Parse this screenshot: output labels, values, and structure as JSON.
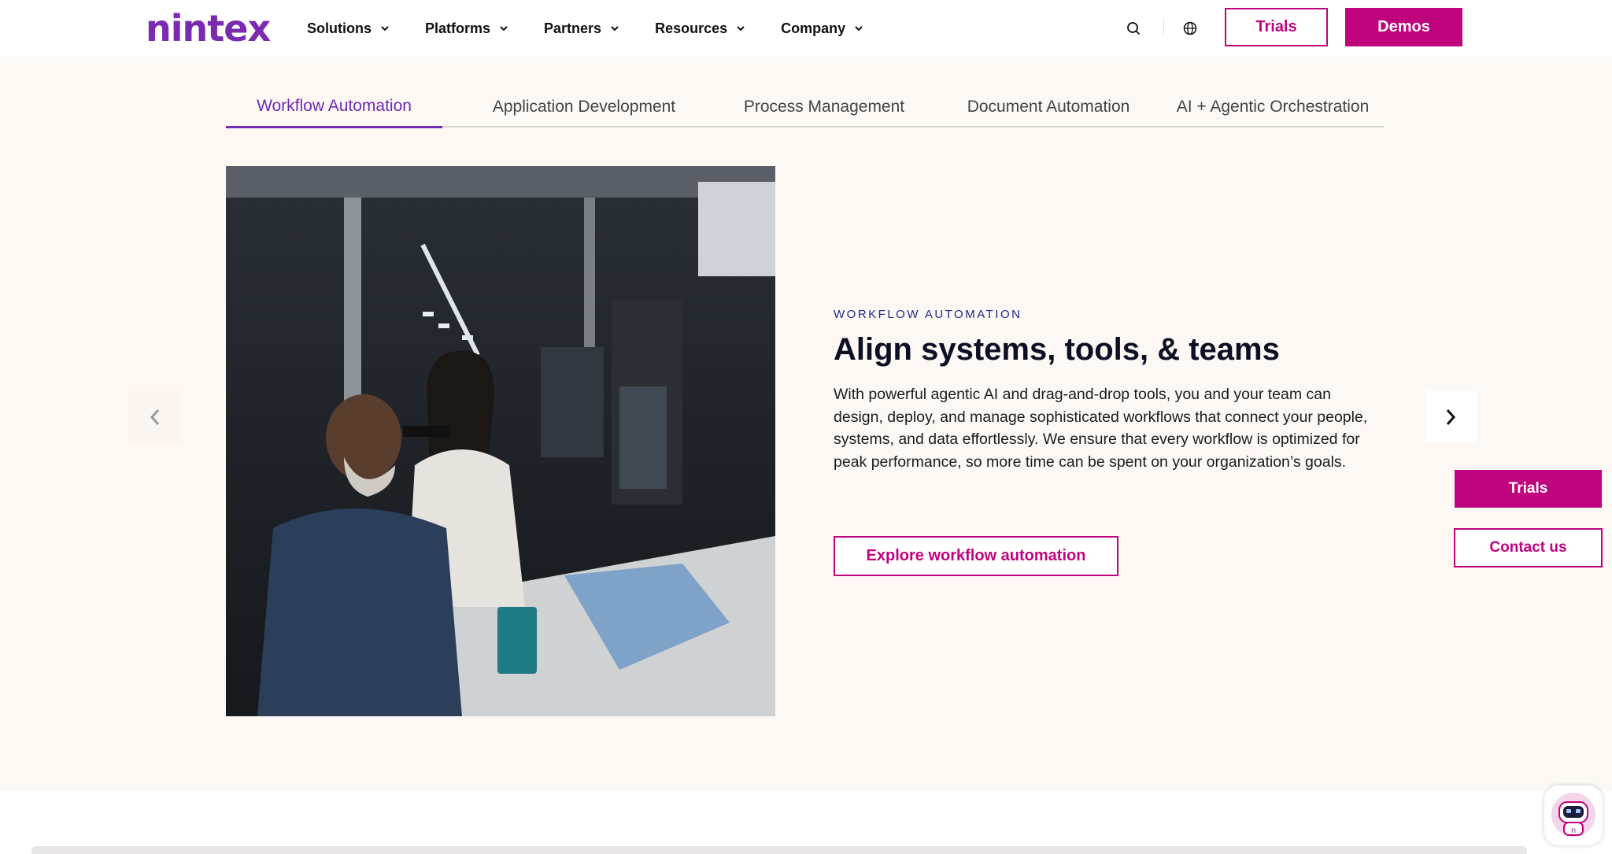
{
  "brand": {
    "logo_text": "nintex",
    "accent": "#c0047e",
    "purple": "#7a2bb0"
  },
  "nav": {
    "items": [
      {
        "label": "Solutions"
      },
      {
        "label": "Platforms"
      },
      {
        "label": "Partners"
      },
      {
        "label": "Resources"
      },
      {
        "label": "Company"
      }
    ],
    "icons": [
      "search-icon",
      "globe-icon"
    ],
    "trials_label": "Trials",
    "demos_label": "Demos"
  },
  "tabs": [
    {
      "label": "Workflow Automation",
      "active": true
    },
    {
      "label": "Application Development",
      "active": false
    },
    {
      "label": "Process Management",
      "active": false
    },
    {
      "label": "Document Automation",
      "active": false
    },
    {
      "label": "AI + Agentic Orchestration",
      "active": false
    }
  ],
  "feature": {
    "eyebrow": "WORKFLOW AUTOMATION",
    "headline": "Align systems, tools, & teams",
    "body": "With powerful agentic AI and drag-and-drop tools, you and your team can design, deploy, and manage sophisticated workflows that connect your people, systems, and data effortlessly. We ensure that every workflow is optimized for peak performance, so more time can be spent on your organization’s goals.",
    "cta_label": "Explore workflow automation"
  },
  "floating": {
    "trials_label": "Trials",
    "contact_label": "Contact us"
  }
}
